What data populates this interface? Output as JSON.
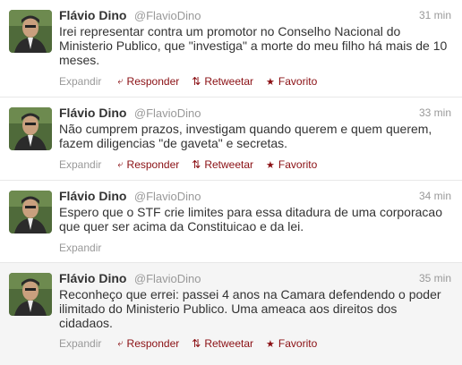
{
  "tweets": [
    {
      "name": "Flávio Dino",
      "handle": "@FlavioDino",
      "time": "31 min",
      "text": "Irei representar contra um promotor no Conselho Nacional do Ministerio Publico, que \"investiga\" a morte do meu filho há mais de 10 meses.",
      "expand": "Expandir",
      "reply": "Responder",
      "retweet": "Retweetar",
      "favorite": "Favorito"
    },
    {
      "name": "Flávio Dino",
      "handle": "@FlavioDino",
      "time": "33 min",
      "text": "Não cumprem prazos, investigam quando querem e quem querem, fazem diligencias \"de gaveta\" e secretas.",
      "expand": "Expandir",
      "reply": "Responder",
      "retweet": "Retweetar",
      "favorite": "Favorito"
    },
    {
      "name": "Flávio Dino",
      "handle": "@FlavioDino",
      "time": "34 min",
      "text": "Espero que o STF crie limites para essa ditadura de uma corporacao que quer ser acima da Constituicao e da lei.",
      "expand": "Expandir"
    },
    {
      "name": "Flávio Dino",
      "handle": "@FlavioDino",
      "time": "35 min",
      "text": "Reconheço que errei: passei 4 anos na Camara defendendo o poder ilimitado do Ministerio Publico. Uma ameaca aos direitos dos cidadaos.",
      "expand": "Expandir",
      "reply": "Responder",
      "retweet": "Retweetar",
      "favorite": "Favorito"
    }
  ],
  "icons": {
    "reply": "reply-arrow-icon",
    "retweet": "retweet-arrows-icon",
    "favorite": "star-icon"
  },
  "colors": {
    "action": "#8a0f13",
    "muted": "#999999",
    "hover_bg": "#f5f5f5"
  }
}
